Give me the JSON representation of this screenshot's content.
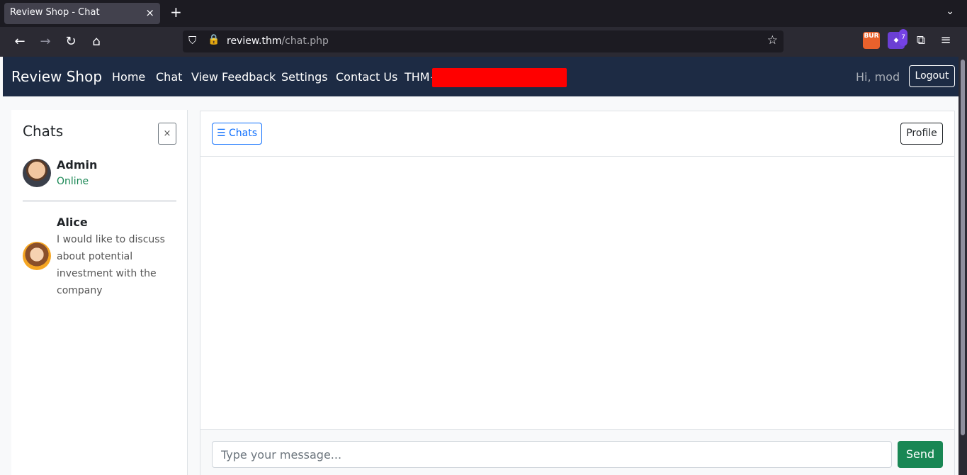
{
  "browser": {
    "tab_title": "Review Shop - Chat",
    "tab_close": "×",
    "new_tab": "+",
    "url_host": "review.thm",
    "url_path": "/chat.php",
    "ext_burp": "BUR",
    "ext_badge_count": "7"
  },
  "site": {
    "brand": "Review Shop",
    "nav": [
      "Home",
      "Chat",
      "View Feedback",
      "Settings",
      "Contact Us",
      "THM{"
    ],
    "greeting": "Hi, mod",
    "logout_label": "Logout"
  },
  "sidebar": {
    "title": "Chats",
    "close_label": "×",
    "chats": [
      {
        "name": "Admin",
        "status": "Online"
      },
      {
        "name": "Alice",
        "preview": "I would like to discuss about potential investment with the company"
      }
    ]
  },
  "main": {
    "chats_toggle_label": "☰ Chats",
    "profile_label": "Profile",
    "input_placeholder": "Type your message...",
    "send_label": "Send"
  }
}
